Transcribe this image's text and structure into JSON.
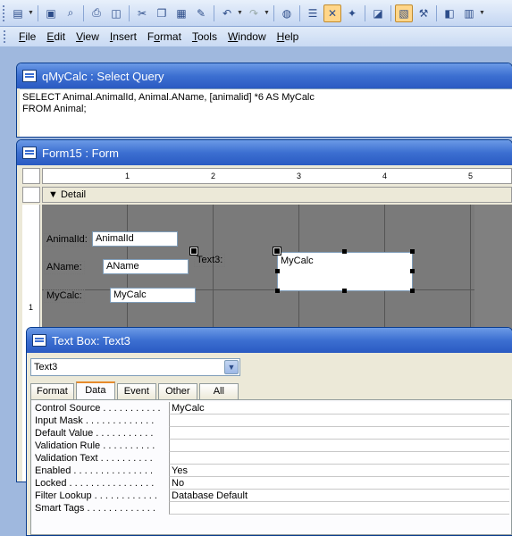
{
  "toolbar": {
    "buttons": [
      "form-view",
      "save",
      "file-search",
      "print",
      "print-preview",
      "cut",
      "copy",
      "paste",
      "format-painter",
      "undo",
      "redo",
      "hyperlink",
      "field-list",
      "toolbox",
      "autoformat",
      "code",
      "properties",
      "build",
      "database-window",
      "new-object"
    ]
  },
  "menu": {
    "items": [
      {
        "key": "F",
        "rest": "ile"
      },
      {
        "key": "E",
        "rest": "dit"
      },
      {
        "key": "V",
        "rest": "iew"
      },
      {
        "key": "I",
        "rest": "nsert"
      },
      {
        "key": "F",
        "rest": "ormat",
        "pre": ""
      },
      {
        "key": "T",
        "rest": "ools"
      },
      {
        "key": "W",
        "rest": "indow"
      },
      {
        "key": "H",
        "rest": "elp"
      }
    ]
  },
  "query_window": {
    "title": "qMyCalc : Select Query",
    "sql_line1": "SELECT Animal.AnimalId, Animal.AName, [animalid] *6 AS MyCalc",
    "sql_line2": "FROM Animal;"
  },
  "form_window": {
    "title": "Form15 : Form",
    "ruler_numbers": [
      "1",
      "2",
      "3",
      "4",
      "5"
    ],
    "vertical_ruler_number": "1",
    "section": "Detail",
    "controls": {
      "animalid_label": "AnimalId:",
      "animalid_text": "AnimalId",
      "aname_label": "AName:",
      "aname_text": "AName",
      "mycalc_label": "MyCalc:",
      "mycalc_text": "MyCalc",
      "text3_label": "Text3:",
      "text3_box": "MyCalc"
    }
  },
  "property_window": {
    "title": "Text Box: Text3",
    "object_selector": "Text3",
    "tabs": [
      "Format",
      "Data",
      "Event",
      "Other",
      "All"
    ],
    "active_tab": "Data",
    "properties": [
      {
        "name": "Control Source . . . . . . . . . . .",
        "value": "MyCalc"
      },
      {
        "name": "Input Mask . . . . . . . . . . . . .",
        "value": ""
      },
      {
        "name": "Default Value . . . . . . . . . . .",
        "value": ""
      },
      {
        "name": "Validation Rule . . . . . . . . . .",
        "value": ""
      },
      {
        "name": "Validation Text . . . . . . . . . .",
        "value": ""
      },
      {
        "name": "Enabled . . . . . . . . . . . . . . .",
        "value": "Yes"
      },
      {
        "name": "Locked . . . . . . . . . . . . . . . .",
        "value": "No"
      },
      {
        "name": "Filter Lookup . . . . . . . . . . . .",
        "value": "Database Default"
      },
      {
        "name": "Smart Tags . . . . . . . . . . . . .",
        "value": ""
      }
    ]
  }
}
